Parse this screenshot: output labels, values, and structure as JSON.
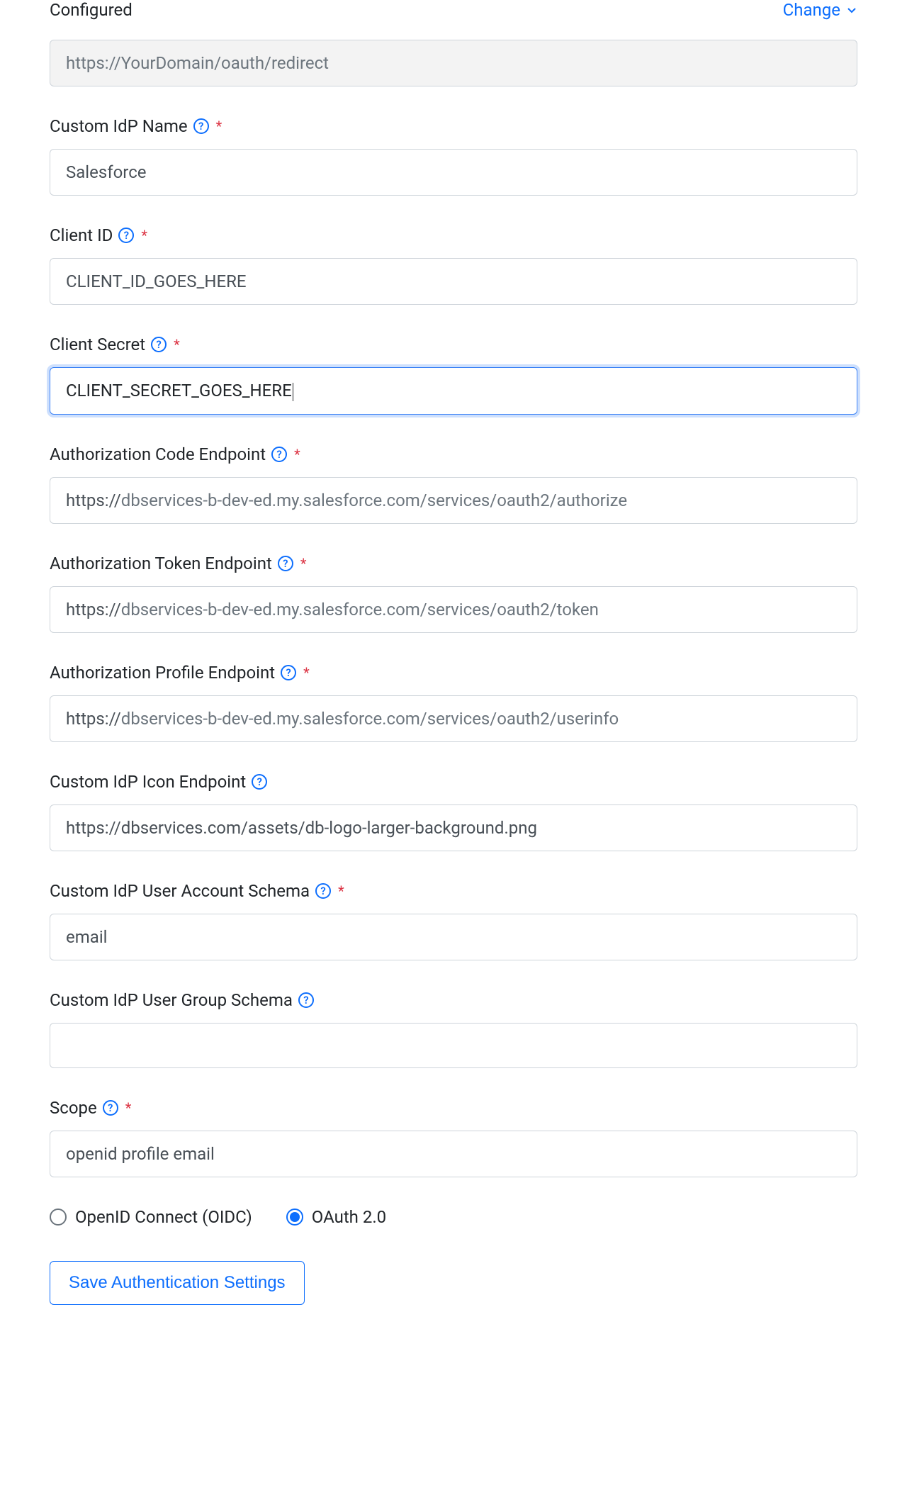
{
  "top": {
    "configured_label": "Configured",
    "change_label": "Change"
  },
  "redirect_url": "https://YourDomain/oauth/redirect",
  "fields": {
    "idp_name": {
      "label": "Custom IdP Name",
      "value": "Salesforce",
      "required": true,
      "help": true
    },
    "client_id": {
      "label": "Client ID",
      "value": "CLIENT_ID_GOES_HERE",
      "required": true,
      "help": true
    },
    "client_secret": {
      "label": "Client Secret",
      "value": "CLIENT_SECRET_GOES_HERE",
      "required": true,
      "help": true,
      "focused": true
    },
    "auth_code": {
      "label": "Authorization Code Endpoint",
      "prefix": "https://",
      "suffix": "dbservices-b-dev-ed.my.salesforce.com/services/oauth2/authorize",
      "required": true,
      "help": true
    },
    "auth_token": {
      "label": "Authorization Token Endpoint",
      "prefix": "https://",
      "suffix": "dbservices-b-dev-ed.my.salesforce.com/services/oauth2/token",
      "required": true,
      "help": true
    },
    "auth_profile": {
      "label": "Authorization Profile Endpoint",
      "prefix": "https://",
      "suffix": "dbservices-b-dev-ed.my.salesforce.com/services/oauth2/userinfo",
      "required": true,
      "help": true
    },
    "icon_endpoint": {
      "label": "Custom IdP Icon Endpoint",
      "value": "https://dbservices.com/assets/db-logo-larger-background.png",
      "required": false,
      "help": true
    },
    "account_schema": {
      "label": "Custom IdP User Account Schema",
      "value": "email",
      "required": true,
      "help": true
    },
    "group_schema": {
      "label": "Custom IdP User Group Schema",
      "value": "",
      "required": false,
      "help": true
    },
    "scope": {
      "label": "Scope",
      "value": "openid profile email",
      "required": true,
      "help": true
    }
  },
  "protocol": {
    "oidc_label": "OpenID Connect (OIDC)",
    "oauth_label": "OAuth 2.0",
    "selected": "oauth"
  },
  "save_button": "Save Authentication Settings"
}
